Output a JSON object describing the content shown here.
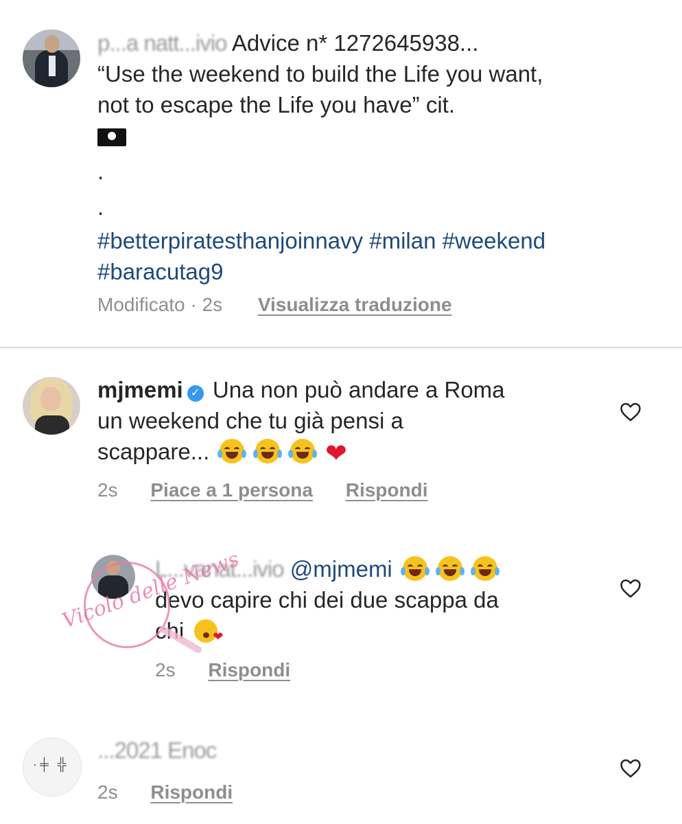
{
  "caption": {
    "masked_username": "p...a natt...ivio",
    "text_line1": "Advice n* 1272645938...",
    "text_line2": "“Use the weekend to build the Life you want,",
    "text_line3": "not to escape the Life you have” cit.",
    "dot1": ".",
    "dot2": ".",
    "hashtags_line1": "#betterpiratesthanjoinnavy #milan #weekend",
    "hashtags_line2": "#baracutag9",
    "status": "Modificato · 2s",
    "translate_link": "Visualizza traduzione"
  },
  "comments": [
    {
      "username": "mjmemi",
      "verified_mark": "✓",
      "line1": "Una non può andare a Roma",
      "line2": "un weekend che tu già pensi a",
      "line3": "scappare...",
      "time": "2s",
      "likes_link": "Piace a 1 persona",
      "reply_link": "Rispondi"
    },
    {
      "masked_username": "L...vanat...ivio",
      "mention": "@mjmemi",
      "line2": "devo capire chi dei due scappa da",
      "line3": "chi",
      "time": "2s",
      "reply_link": "Rispondi"
    },
    {
      "masked_username": "...2021 Enoc",
      "time": "2s",
      "reply_link": "Rispondi"
    }
  ],
  "watermark_text": "Vicolo delle News",
  "icons": {
    "like": "heart-outline-icon",
    "verified": "verified-badge-icon",
    "flag": "pirate-flag-emoji",
    "laugh": "tears-of-joy-emoji",
    "heart": "red-heart-emoji",
    "kiss": "kissing-heart-emoji"
  }
}
